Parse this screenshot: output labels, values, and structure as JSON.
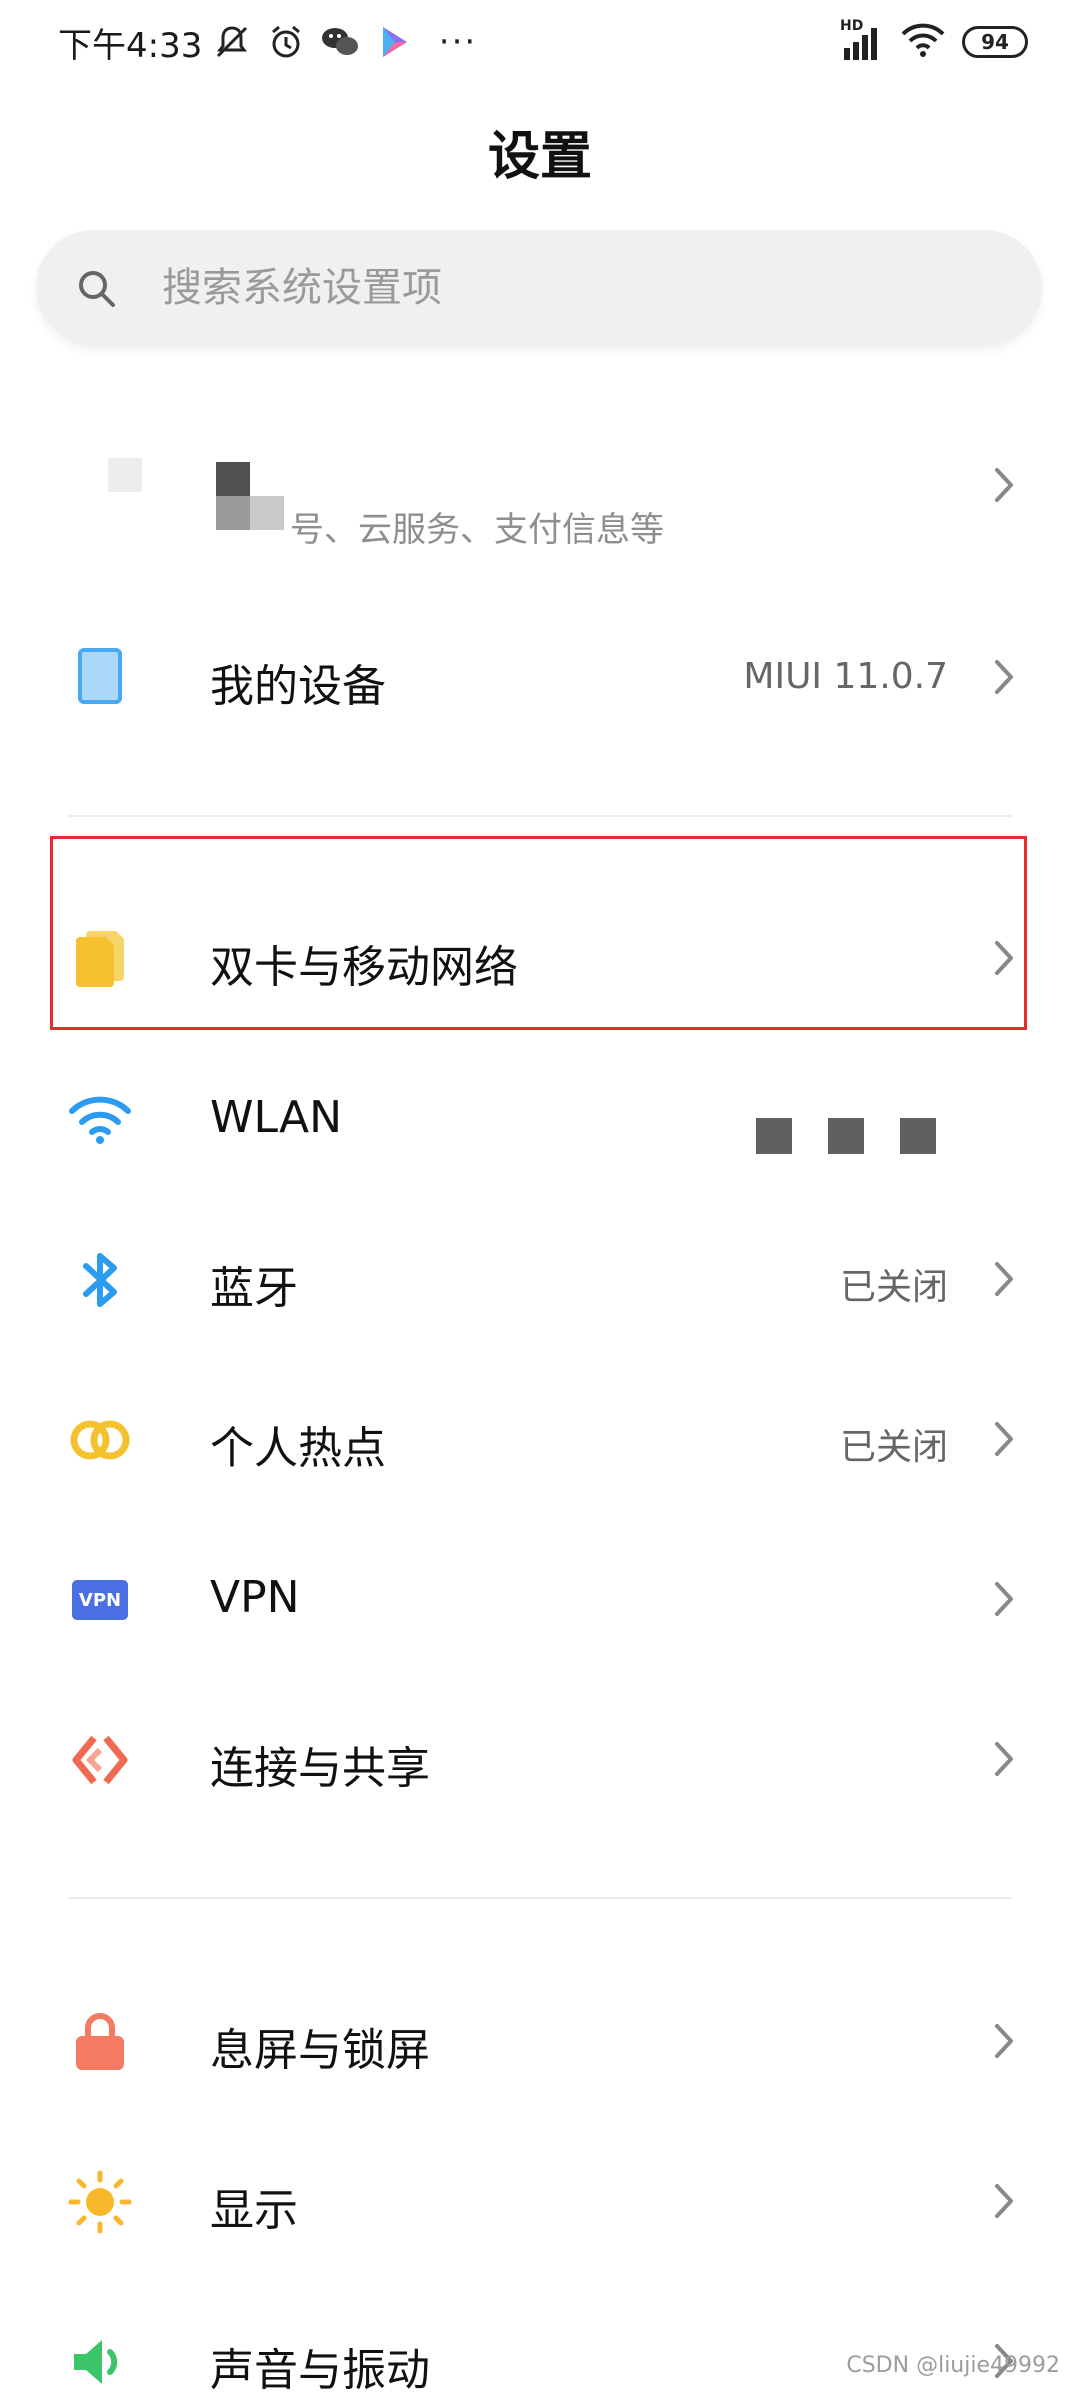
{
  "status_bar": {
    "time": "下午4:33",
    "icons": [
      "notifications-off-icon",
      "alarm-icon",
      "wechat-icon",
      "play-store-icon",
      "more-dots-icon"
    ],
    "signal_label": "HD",
    "battery": "94"
  },
  "header": {
    "title": "设置"
  },
  "search": {
    "placeholder": "搜索系统设置项"
  },
  "account": {
    "subtitle": "号、云服务、支付信息等"
  },
  "sections": [
    {
      "items": [
        {
          "label": "我的设备",
          "value": "MIUI 11.0.7",
          "icon": "tablet-icon"
        }
      ]
    },
    {
      "items": [
        {
          "label": "双卡与移动网络",
          "icon": "sim-card-icon",
          "highlighted": true
        },
        {
          "label": "WLAN",
          "icon": "wifi-icon"
        },
        {
          "label": "蓝牙",
          "value": "已关闭",
          "icon": "bluetooth-icon"
        },
        {
          "label": "个人热点",
          "value": "已关闭",
          "icon": "hotspot-icon"
        },
        {
          "label": "VPN",
          "icon": "vpn-icon",
          "icon_text": "VPN"
        },
        {
          "label": "连接与共享",
          "icon": "share-connect-icon"
        }
      ]
    },
    {
      "items": [
        {
          "label": "息屏与锁屏",
          "icon": "lock-icon"
        },
        {
          "label": "显示",
          "icon": "sun-icon"
        },
        {
          "label": "声音与振动",
          "icon": "speaker-icon"
        }
      ]
    }
  ],
  "watermark": "CSDN @liujie49992",
  "colors": {
    "highlight_border": "#e52b2b",
    "sim_icon": "#f5c12e",
    "wifi_icon": "#2b9bf0",
    "bluetooth_icon": "#2b9bf0",
    "hotspot_icon": "#f5c12e",
    "vpn_icon": "#4a6fe3",
    "share_icon": "#f06a54",
    "lock_icon": "#f47a63",
    "sun_icon": "#f7b92b",
    "speaker_icon": "#3cc469",
    "tablet_icon": "#4aa8f0"
  }
}
